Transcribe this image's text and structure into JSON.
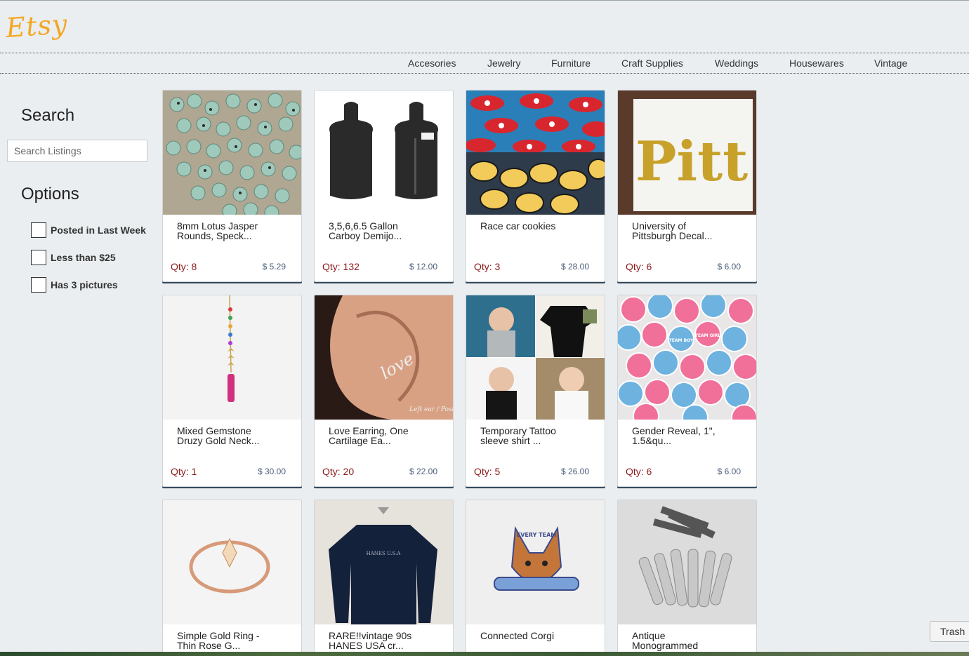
{
  "header": {
    "logo_text": "Etsy",
    "brand_color": "#f5a623"
  },
  "nav": {
    "items": [
      "Accesories",
      "Jewelry",
      "Furniture",
      "Craft Supplies",
      "Weddings",
      "Housewares",
      "Vintage"
    ]
  },
  "sidebar": {
    "search_heading": "Search",
    "search_placeholder": "Search Listings",
    "options_heading": "Options",
    "options": [
      "Posted in Last Week",
      "Less than $25",
      "Has 3 pictures"
    ]
  },
  "listings": [
    {
      "title1": "8mm Lotus Jasper",
      "title2": "Rounds, Speck...",
      "qty": "Qty: 8",
      "price": "$ 5.29"
    },
    {
      "title1": "3,5,6,6.5 Gallon",
      "title2": "Carboy Demijo...",
      "qty": "Qty: 132",
      "price": "$ 12.00"
    },
    {
      "title1": "Race car cookies",
      "title2": "",
      "qty": "Qty: 3",
      "price": "$ 28.00"
    },
    {
      "title1": "University of",
      "title2": "Pittsburgh Decal...",
      "qty": "Qty: 6",
      "price": "$ 6.00"
    },
    {
      "title1": "Mixed Gemstone",
      "title2": "Druzy Gold Neck...",
      "qty": "Qty: 1",
      "price": "$ 30.00"
    },
    {
      "title1": "Love Earring, One",
      "title2": "Cartilage Ea...",
      "qty": "Qty: 20",
      "price": "$ 22.00"
    },
    {
      "title1": "Temporary Tattoo",
      "title2": "sleeve shirt ...",
      "qty": "Qty: 5",
      "price": "$ 26.00"
    },
    {
      "title1": "Gender Reveal, 1\",",
      "title2": "1.5&qu...",
      "qty": "Qty: 6",
      "price": "$ 6.00"
    },
    {
      "title1": "Simple Gold Ring -",
      "title2": "Thin Rose G...",
      "qty": "",
      "price": ""
    },
    {
      "title1": "RARE!!vintage 90s",
      "title2": "HANES USA cr...",
      "qty": "",
      "price": ""
    },
    {
      "title1": "Connected Corgi",
      "title2": "",
      "qty": "",
      "price": ""
    },
    {
      "title1": "Antique",
      "title2": "Monogrammed",
      "qty": "",
      "price": ""
    }
  ],
  "image_text": {
    "pitt": "Pitt",
    "earring": "love",
    "earring_caption": "Left ear / Post at the \"L\"",
    "team_boy": "TEAM BOY",
    "team_girl": "TEAM GIRL",
    "sweatshirt": "HANES U.S.A",
    "corgi": "EVERY TEAM"
  },
  "dock": {
    "trash_label": "Trash"
  }
}
